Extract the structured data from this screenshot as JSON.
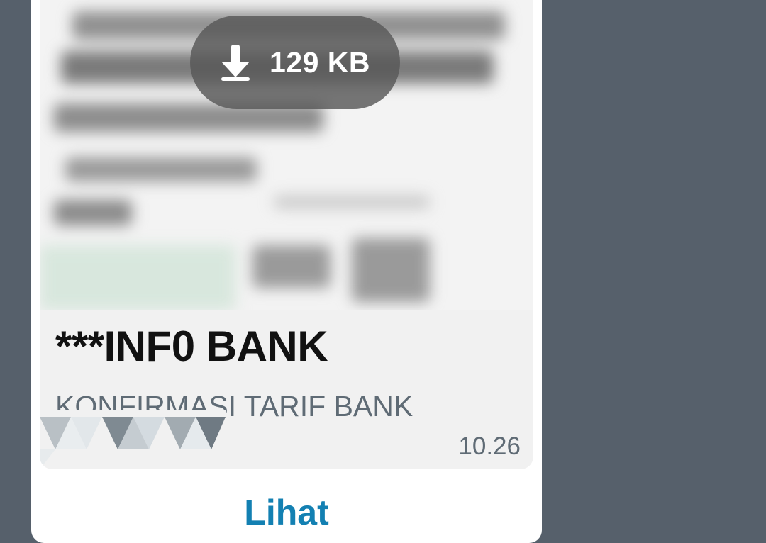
{
  "message": {
    "download": {
      "icon": "download-arrow-icon",
      "size_label": "129 KB"
    },
    "caption": {
      "title": "***INF0 BANK",
      "subtitle": "KONFIRMASI TARIF BANK",
      "time": "10.26"
    },
    "action": {
      "label": "Lihat"
    }
  },
  "colors": {
    "background": "#56606b",
    "bubble": "#ffffff",
    "caption_background": "#f1f1f1",
    "title": "#111111",
    "subtitle": "#5f6b75",
    "action": "#1380b2",
    "download_pill": "#585858"
  }
}
